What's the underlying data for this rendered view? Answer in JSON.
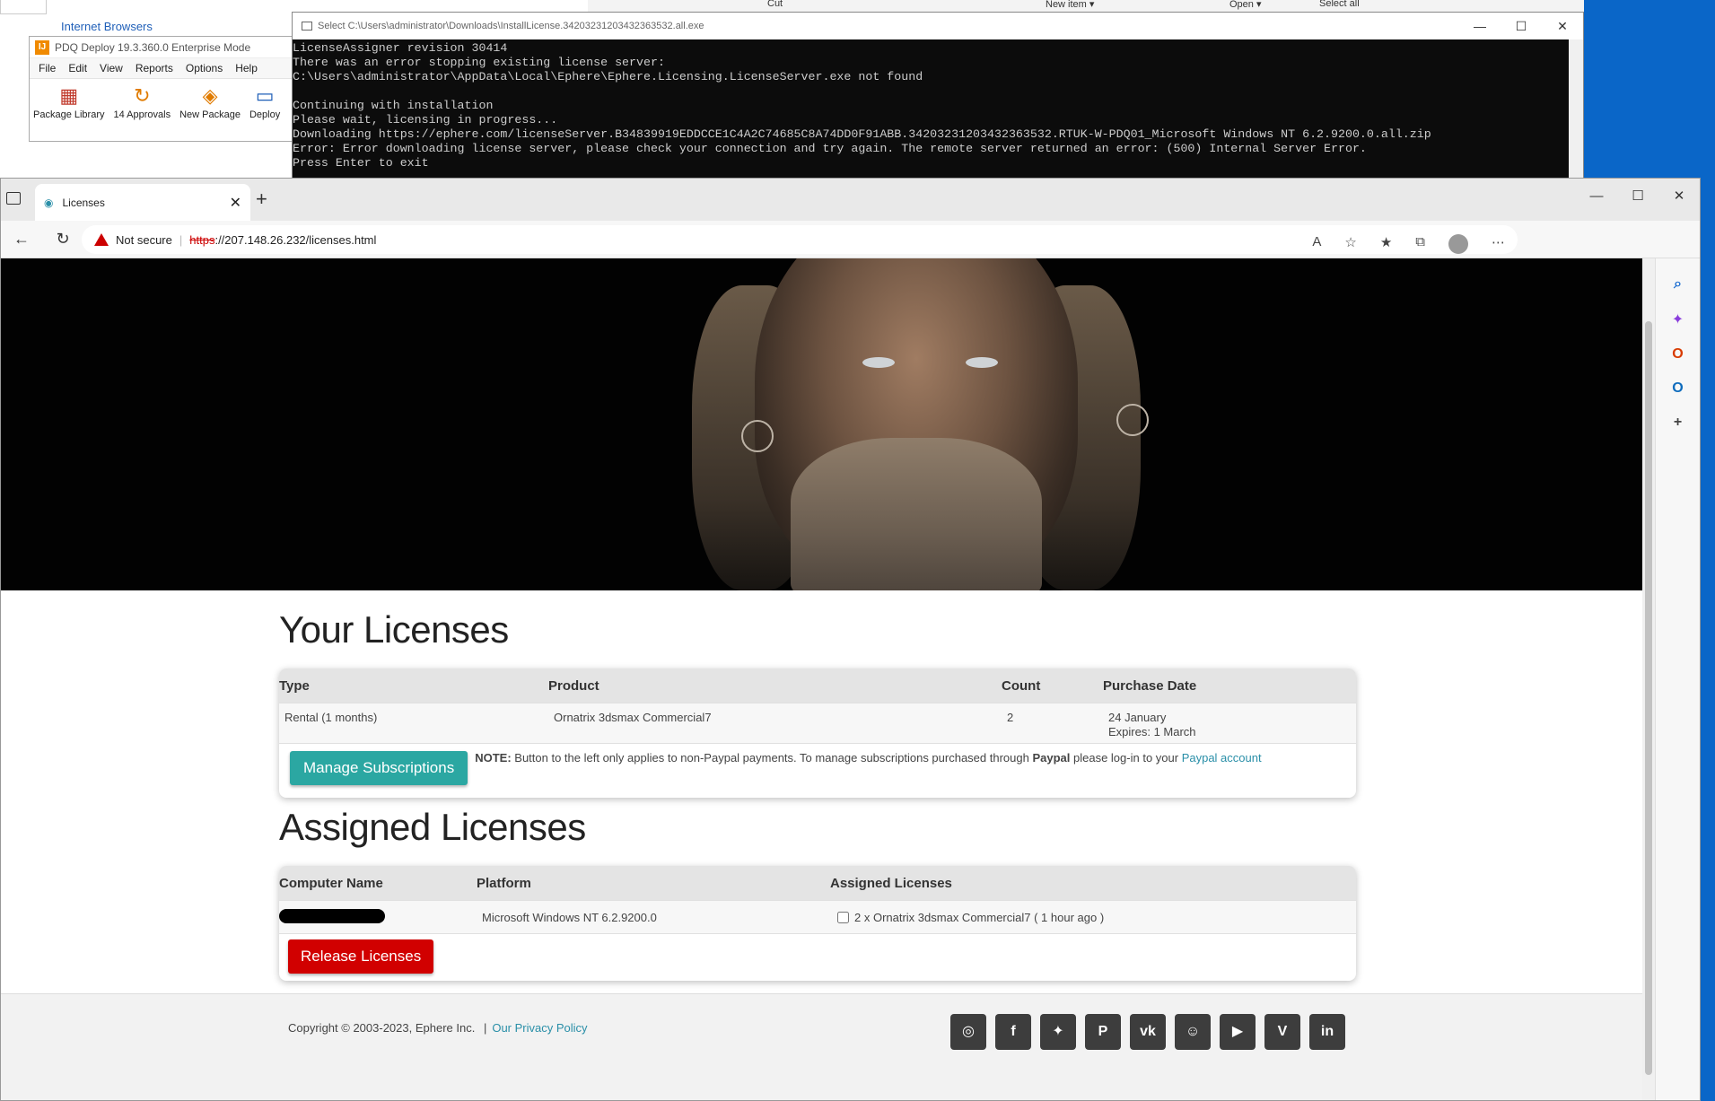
{
  "explorer": {
    "ie_label": "Internet Browsers"
  },
  "ribbon": {
    "cut": "Cut",
    "new_item": "New item ▾",
    "open": "Open ▾",
    "select_all": "Select all"
  },
  "pdq": {
    "title": "PDQ Deploy 19.3.360.0 Enterprise Mode",
    "menu": [
      "File",
      "Edit",
      "View",
      "Reports",
      "Options",
      "Help"
    ],
    "tools": [
      "Package Library",
      "14 Approvals",
      "New Package",
      "Deploy"
    ]
  },
  "console": {
    "title": "Select C:\\Users\\administrator\\Downloads\\InstallLicense.34203231203432363532.all.exe",
    "lines": [
      "LicenseAssigner revision 30414",
      "There was an error stopping existing license server:",
      "C:\\Users\\administrator\\AppData\\Local\\Ephere\\Ephere.Licensing.LicenseServer.exe not found",
      "",
      "Continuing with installation",
      "Please wait, licensing in progress...",
      "Downloading https://ephere.com/licenseServer.B34839919EDDCCE1C4A2C74685C8A74DD0F91ABB.34203231203432363532.RTUK-W-PDQ01_Microsoft Windows NT 6.2.9200.0.all.zip",
      "Error: Error downloading license server, please check your connection and try again. The remote server returned an error: (500) Internal Server Error.",
      "Press Enter to exit"
    ]
  },
  "browser": {
    "tab_title": "Licenses",
    "not_secure": "Not secure",
    "url_scheme": "https",
    "url_rest": "://207.148.26.232/licenses.html"
  },
  "licenses": {
    "heading": "Your Licenses",
    "columns": [
      "Type",
      "Product",
      "Count",
      "Purchase Date"
    ],
    "row": {
      "type": "Rental (1 months)",
      "product": "Ornatrix 3dsmax Commercial7",
      "count": "2",
      "purchase_date": "24 January",
      "expires": "Expires: 1 March"
    },
    "manage_button": "Manage Subscriptions",
    "note_label": "NOTE:",
    "note_text": " Button to the left only applies to non-Paypal payments. To manage subscriptions purchased through ",
    "note_paypal": "Paypal",
    "note_text2": " please log-in to your ",
    "note_link": "Paypal account"
  },
  "assigned": {
    "heading": "Assigned Licenses",
    "columns": [
      "Computer Name",
      "Platform",
      "Assigned Licenses"
    ],
    "row": {
      "platform": "Microsoft Windows NT 6.2.9200.0",
      "assigned": "2 x Ornatrix 3dsmax Commercial7 ( 1 hour ago )"
    },
    "release_button": "Release Licenses"
  },
  "footer": {
    "copyright": "Copyright © 2003-2023, Ephere Inc.",
    "separator": "|",
    "privacy": "Our Privacy Policy"
  }
}
